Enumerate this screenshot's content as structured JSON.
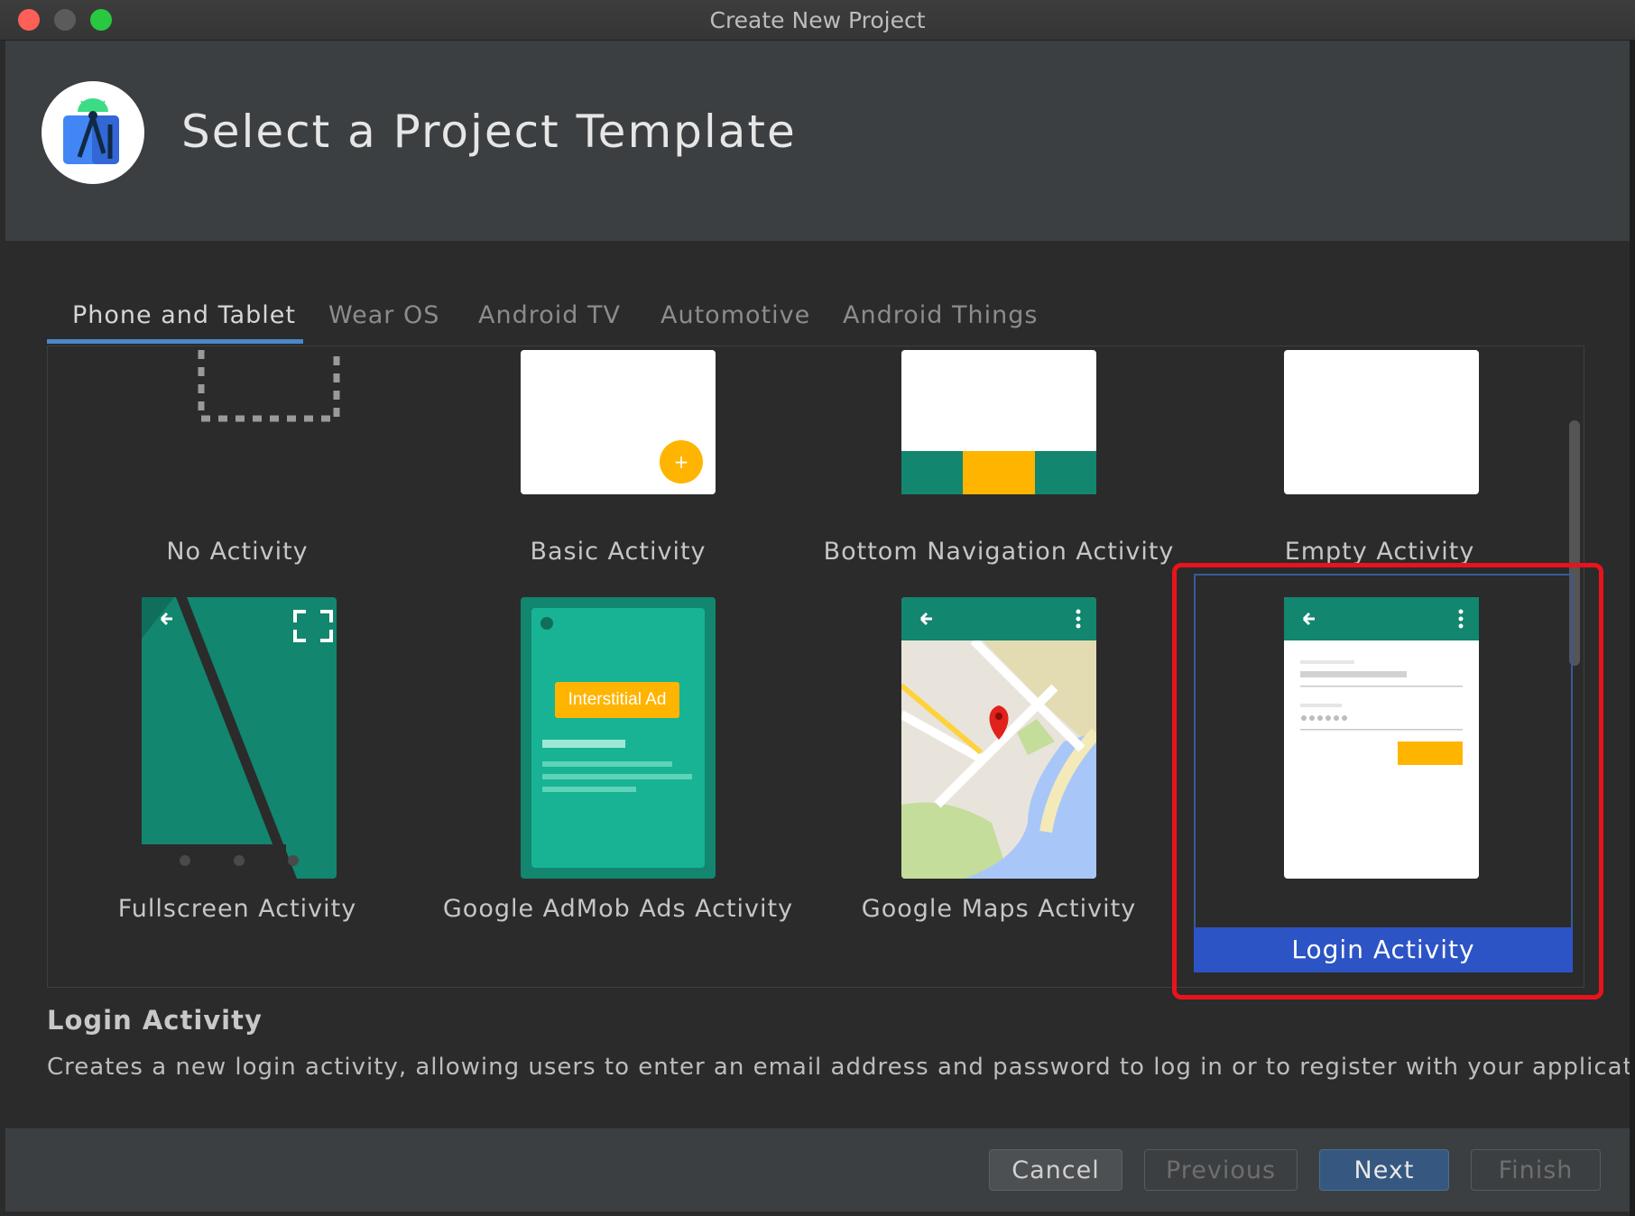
{
  "window": {
    "title": "Create New Project"
  },
  "header": {
    "title": "Select a Project Template",
    "logo_icon": "android-studio-icon"
  },
  "tabs": [
    {
      "label": "Phone and Tablet",
      "active": true
    },
    {
      "label": "Wear OS",
      "active": false
    },
    {
      "label": "Android TV",
      "active": false
    },
    {
      "label": "Automotive",
      "active": false
    },
    {
      "label": "Android Things",
      "active": false
    }
  ],
  "templates": [
    {
      "label": "No Activity"
    },
    {
      "label": "Basic Activity"
    },
    {
      "label": "Bottom Navigation Activity"
    },
    {
      "label": "Empty Activity"
    },
    {
      "label": "Fullscreen Activity"
    },
    {
      "label": "Google AdMob Ads Activity",
      "thumb_text": "Interstitial Ad"
    },
    {
      "label": "Google Maps Activity"
    },
    {
      "label": "Login Activity",
      "selected": true
    }
  ],
  "description": {
    "title": "Login Activity",
    "text": "Creates a new login activity, allowing users to enter an email address and password to log in or to register with your application"
  },
  "buttons": {
    "cancel": "Cancel",
    "previous": "Previous",
    "next": "Next",
    "finish": "Finish"
  },
  "colors": {
    "accent": "#2d54c5",
    "highlight": "#e8131c",
    "teal": "#12866f",
    "amber": "#ffb400"
  }
}
